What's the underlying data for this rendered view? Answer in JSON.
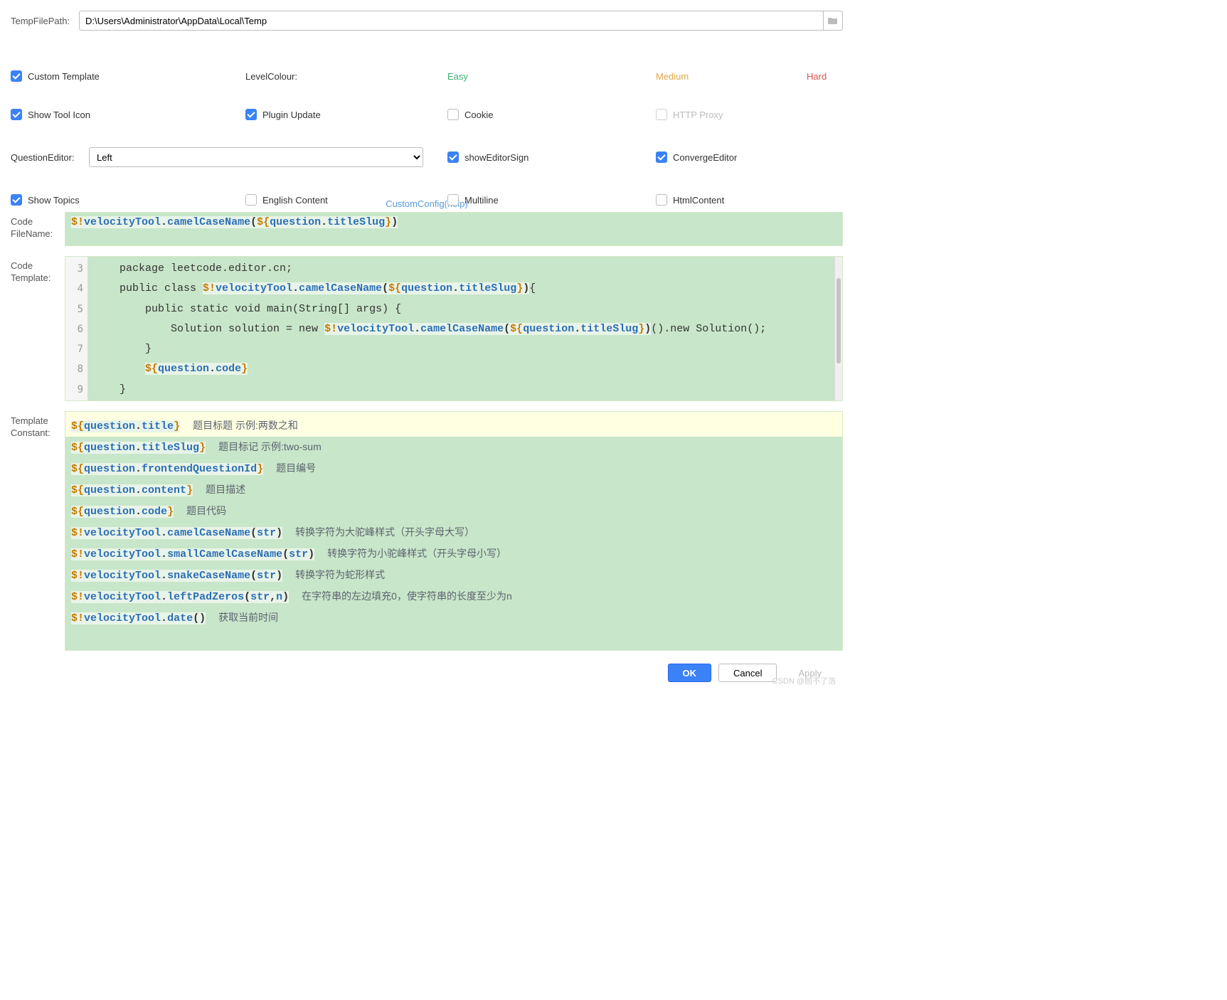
{
  "tempFilePath": {
    "label": "TempFilePath:",
    "value": "D:\\Users\\Administrator\\AppData\\Local\\Temp"
  },
  "row1": {
    "customTemplate": "Custom Template",
    "levelColour": "LevelColour:",
    "easy": "Easy",
    "medium": "Medium",
    "hard": "Hard"
  },
  "row2": {
    "showToolIcon": "Show Tool Icon",
    "pluginUpdate": "Plugin Update",
    "cookie": "Cookie",
    "httpProxy": "HTTP Proxy"
  },
  "row3": {
    "questionEditor": "QuestionEditor:",
    "option": "Left",
    "showEditorSign": "showEditorSign",
    "convergeEditor": "ConvergeEditor"
  },
  "row4": {
    "showTopics": "Show Topics",
    "englishContent": "English Content",
    "multiline": "Multiline",
    "htmlContent": "HtmlContent"
  },
  "help": "CustomConfig(help)",
  "labels": {
    "codeFileName": "Code FileName:",
    "codeTemplate": "Code Template:",
    "templateConstant": "Template Constant:"
  },
  "codeFileName": {
    "tok": {
      "d": "$!",
      "id1": "velocityTool",
      "id2": "camelCaseName",
      "d2": "${",
      "id3": "question",
      "id4": "titleSlug",
      "d3": "}"
    }
  },
  "codeTemplate": {
    "lines": [
      "3",
      "4",
      "5",
      "6",
      "7",
      "8",
      "9"
    ],
    "l1_a": "    package leetcode.editor.cn;",
    "l2_a": "    public class ",
    "l2_d": "$!",
    "l2_id1": "velocityTool",
    "l2_id2": "camelCaseName",
    "l2_db": "${",
    "l2_id3": "question",
    "l2_id4": "titleSlug",
    "l2_de": "}",
    "l2_b": "{",
    "l3": "        public static void main(String[] args) {",
    "l4_a": "            Solution solution = new ",
    "l4_d": "$!",
    "l4_id1": "velocityTool",
    "l4_id2": "camelCaseName",
    "l4_db": "${",
    "l4_id3": "question",
    "l4_id4": "titleSlug",
    "l4_de": "}",
    "l4_b": "().new Solution();",
    "l5": "        }",
    "l6_db": "${",
    "l6_id1": "question",
    "l6_id2": "code",
    "l6_de": "}",
    "l6_pre": "        ",
    "l7": "    }"
  },
  "constants": {
    "c1": {
      "db": "${",
      "id1": "question",
      "id2": "title",
      "de": "}",
      "desc": "题目标题  示例:两数之和"
    },
    "c2": {
      "db": "${",
      "id1": "question",
      "id2": "titleSlug",
      "de": "}",
      "desc": "题目标记  示例:two-sum"
    },
    "c3": {
      "db": "${",
      "id1": "question",
      "id2": "frontendQuestionId",
      "de": "}",
      "desc": "题目编号"
    },
    "c4": {
      "db": "${",
      "id1": "question",
      "id2": "content",
      "de": "}",
      "desc": "题目描述"
    },
    "c5": {
      "db": "${",
      "id1": "question",
      "id2": "code",
      "de": "}",
      "desc": "题目代码"
    },
    "c6": {
      "d": "$!",
      "id1": "velocityTool",
      "id2": "camelCaseName",
      "arg": "str",
      "desc": "转换字符为大驼峰样式（开头字母大写）"
    },
    "c7": {
      "d": "$!",
      "id1": "velocityTool",
      "id2": "smallCamelCaseName",
      "arg": "str",
      "desc": "转换字符为小驼峰样式（开头字母小写）"
    },
    "c8": {
      "d": "$!",
      "id1": "velocityTool",
      "id2": "snakeCaseName",
      "arg": "str",
      "desc": "转换字符为蛇形样式"
    },
    "c9": {
      "d": "$!",
      "id1": "velocityTool",
      "id2": "leftPadZeros",
      "arg": "str",
      "arg2": "n",
      "desc": "在字符串的左边填充0，使字符串的长度至少为n"
    },
    "c10": {
      "d": "$!",
      "id1": "velocityTool",
      "id2": "date",
      "desc": "获取当前时间"
    }
  },
  "buttons": {
    "ok": "OK",
    "cancel": "Cancel",
    "apply": "Apply"
  },
  "watermark": "CSDN @刨不了浩"
}
